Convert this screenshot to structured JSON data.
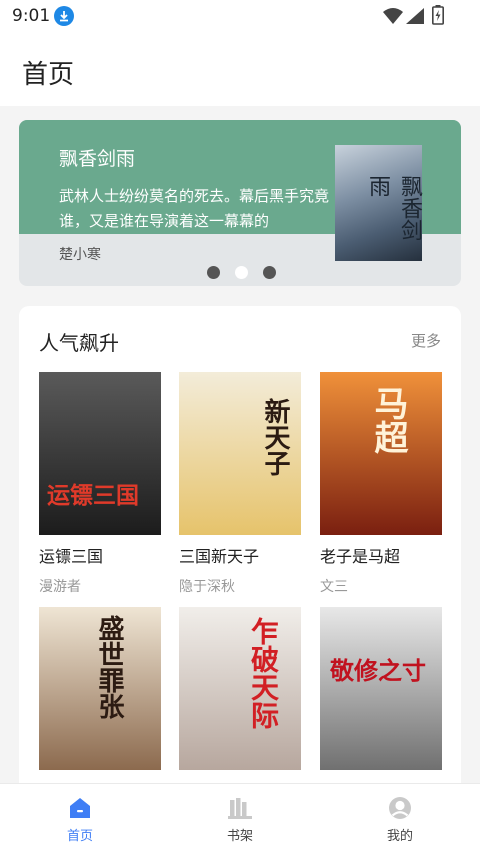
{
  "status_bar": {
    "time": "9:01"
  },
  "header": {
    "title": "首页"
  },
  "banner": {
    "title": "飘香剑雨",
    "description": "武林人士纷纷莫名的死去。幕后黑手究竟谁，又是谁在导演着这一幕幕的",
    "author": "楚小寒",
    "cover_text": "飘香剑雨",
    "slide_count": 3,
    "active_slide": 2
  },
  "section": {
    "title": "人气飙升",
    "more_label": "更多",
    "books": [
      {
        "title": "运镖三国",
        "author": "漫游者",
        "cover_text": "运镖三国",
        "cover_colors": [
          "#5a5a5a",
          "#1c1c1c"
        ],
        "text_color": "#e03a2a"
      },
      {
        "title": "三国新天子",
        "author": "隐于深秋",
        "cover_text": "新天子",
        "cover_colors": [
          "#f3ecd9",
          "#e6c36b"
        ],
        "text_color": "#2b1b12"
      },
      {
        "title": "老子是马超",
        "author": "文三",
        "cover_text": "马超",
        "cover_colors": [
          "#f0913a",
          "#7a1f10"
        ],
        "text_color": "#fff3d9"
      },
      {
        "title": "盛世罪张",
        "author": "",
        "cover_text": "盛世罪张",
        "cover_colors": [
          "#efe5d4",
          "#8c6a4e"
        ],
        "text_color": "#2c1b12"
      },
      {
        "title": "乍破天际",
        "author": "",
        "cover_text": "乍破天际",
        "cover_colors": [
          "#f1eeea",
          "#b7a79e"
        ],
        "text_color": "#d21f24"
      },
      {
        "title": "敬修之寸",
        "author": "",
        "cover_text": "敬修之寸",
        "cover_colors": [
          "#e8e8e8",
          "#707070"
        ],
        "text_color": "#c1121f"
      }
    ]
  },
  "tabs": [
    {
      "label": "首页",
      "icon": "home-icon",
      "active": true
    },
    {
      "label": "书架",
      "icon": "bookshelf-icon",
      "active": false
    },
    {
      "label": "我的",
      "icon": "profile-icon",
      "active": false
    }
  ],
  "colors": {
    "accent": "#3f7ef5",
    "banner_bg": "#6aa98e"
  }
}
